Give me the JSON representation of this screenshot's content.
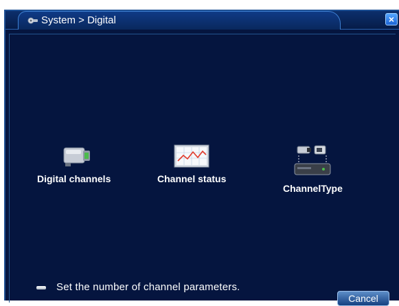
{
  "window": {
    "title": "System > Digital",
    "close_label": "×"
  },
  "features": [
    {
      "label": "Digital channels",
      "icon": "camera-icon"
    },
    {
      "label": "Channel status",
      "icon": "chart-icon"
    },
    {
      "label": "ChannelType",
      "icon": "dvr-icon"
    }
  ],
  "hint": {
    "text": "Set the number of channel parameters."
  },
  "buttons": {
    "cancel": "Cancel"
  },
  "colors": {
    "background": "#05153f",
    "title_bar": "#0c2f6c",
    "accent": "#3e80d2"
  }
}
